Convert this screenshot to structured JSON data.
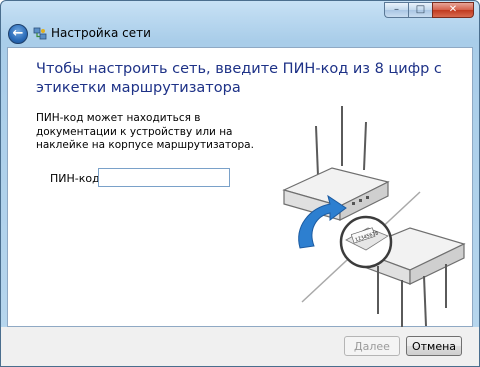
{
  "window": {
    "title": "Настройка сети",
    "controls": {
      "minimize": "–",
      "maximize": "□",
      "close": "✕"
    },
    "back_icon": "back-arrow-icon",
    "app_icon": "network-icon"
  },
  "main": {
    "heading": "Чтобы настроить сеть, введите ПИН-код из 8 цифр с этикетки маршрутизатора",
    "description": "ПИН-код может находиться в документации к устройству или на наклейке на корпусе маршрутизатора.",
    "pin_label": "ПИН-код:",
    "pin_value": "",
    "illustration": "router-pin-illustration",
    "label_text": "12345678"
  },
  "footer": {
    "next_label": "Далее",
    "next_enabled": false,
    "cancel_label": "Отмена"
  },
  "colors": {
    "heading": "#1e3287",
    "frame": "#b8d7ee",
    "close_button": "#c0391f",
    "arrow": "#2d7fd0"
  }
}
